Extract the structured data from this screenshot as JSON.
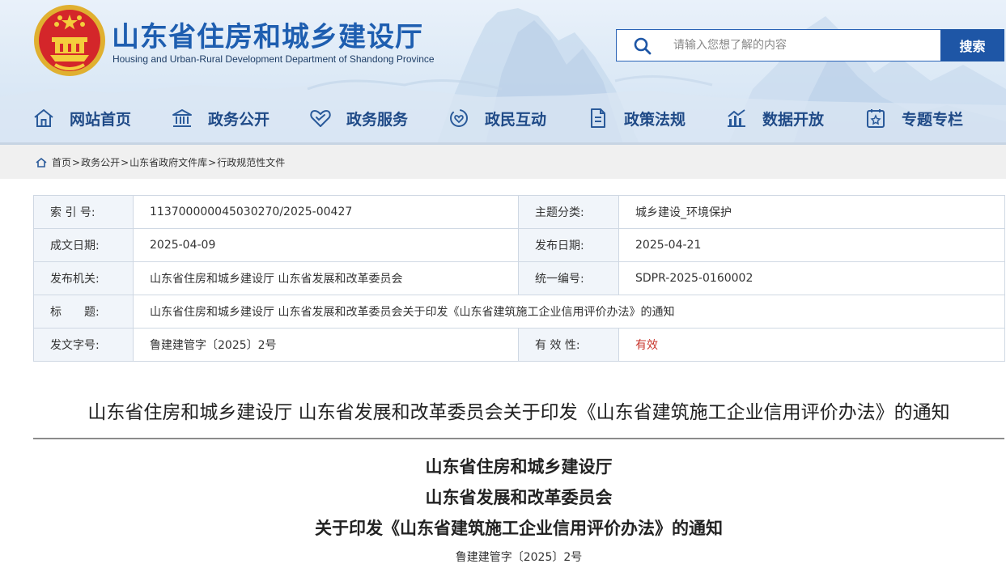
{
  "header": {
    "title": "山东省住房和城乡建设厅",
    "subtitle": "Housing and Urban-Rural Development Department of Shandong Province",
    "emblem_icon": "national-emblem",
    "brand_color": "#1e5eb0"
  },
  "search": {
    "placeholder": "请输入您想了解的内容",
    "button_label": "搜索",
    "icon": "search-icon"
  },
  "nav": {
    "items": [
      {
        "label": "网站首页",
        "icon": "home-icon"
      },
      {
        "label": "政务公开",
        "icon": "government-building-icon"
      },
      {
        "label": "政务服务",
        "icon": "handshake-heart-icon"
      },
      {
        "label": "政民互动",
        "icon": "interaction-icon"
      },
      {
        "label": "政策法规",
        "icon": "document-icon"
      },
      {
        "label": "数据开放",
        "icon": "bar-chart-icon"
      },
      {
        "label": "专题专栏",
        "icon": "topic-icon"
      }
    ]
  },
  "breadcrumb": {
    "items": [
      "首页",
      "政务公开",
      "山东省政府文件库",
      "行政规范性文件"
    ],
    "separator": ">"
  },
  "info": {
    "index_label": "索 引 号:",
    "index_value": "113700000045030270/2025-00427",
    "topic_label": "主题分类:",
    "topic_value": "城乡建设_环境保护",
    "written_date_label": "成文日期:",
    "written_date_value": "2025-04-09",
    "publish_date_label": "发布日期:",
    "publish_date_value": "2025-04-21",
    "issuer_label": "发布机关:",
    "issuer_value": "山东省住房和城乡建设厅 山东省发展和改革委员会",
    "unified_no_label": "统一编号:",
    "unified_no_value": "SDPR-2025-0160002",
    "title_label": "标　　题:",
    "title_value": "山东省住房和城乡建设厅 山东省发展和改革委员会关于印发《山东省建筑施工企业信用评价办法》的通知",
    "doc_no_label": "发文字号:",
    "doc_no_value": "鲁建建管字〔2025〕2号",
    "validity_label": "有 效 性:",
    "validity_value": "有效",
    "validity_color": "#c8362d"
  },
  "document": {
    "heading": "山东省住房和城乡建设厅 山东省发展和改革委员会关于印发《山东省建筑施工企业信用评价办法》的通知",
    "line1": "山东省住房和城乡建设厅",
    "line2": "山东省发展和改革委员会",
    "line3": "关于印发《山东省建筑施工企业信用评价办法》的通知",
    "doc_number": "鲁建建管字〔2025〕2号"
  }
}
